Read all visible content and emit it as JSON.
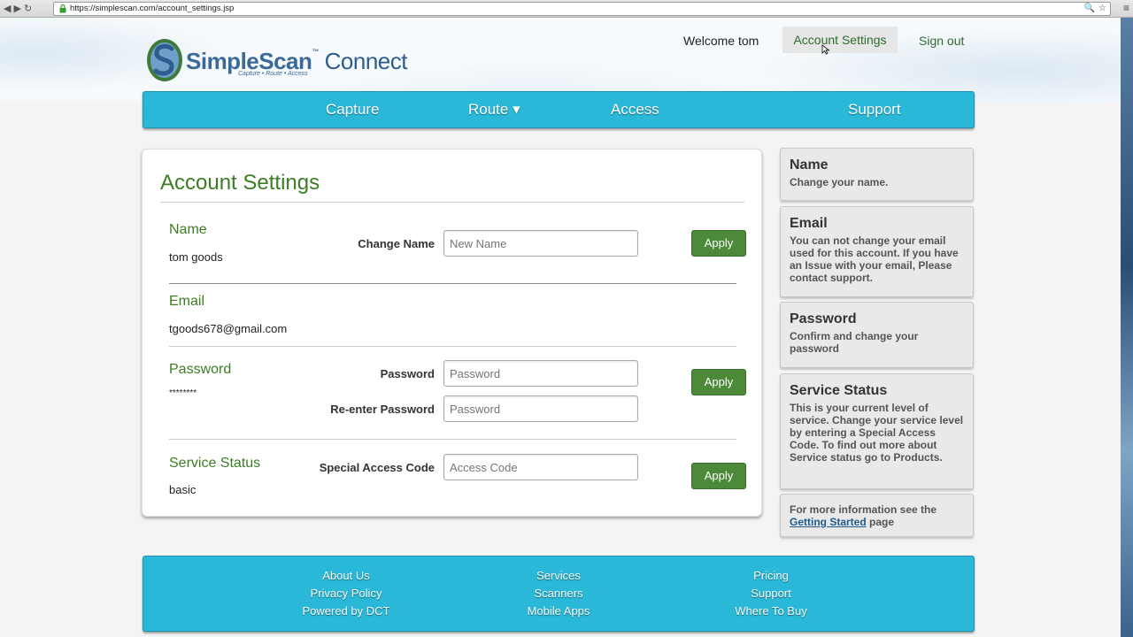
{
  "browser": {
    "url": "https://simplescan.com/account_settings.jsp",
    "nav_glyphs": "◀ ▶ ↻"
  },
  "logo": {
    "brand": "SimpleScan",
    "tm": "™",
    "product": "Connect",
    "tagline": "Capture • Route • Access"
  },
  "header": {
    "welcome": "Welcome tom",
    "account_settings": "Account Settings",
    "sign_out": "Sign out"
  },
  "nav": {
    "capture": "Capture",
    "route": "Route ▾",
    "access": "Access",
    "support": "Support"
  },
  "main": {
    "title": "Account Settings",
    "name": {
      "label": "Name",
      "value": "tom goods",
      "field_label": "Change Name",
      "placeholder": "New Name",
      "apply": "Apply"
    },
    "email": {
      "label": "Email",
      "value": "tgoods678@gmail.com"
    },
    "password": {
      "label": "Password",
      "value": "********",
      "field_label": "Password",
      "placeholder": "Password",
      "reenter_label": "Re-enter Password",
      "reenter_placeholder": "Password",
      "apply": "Apply"
    },
    "service": {
      "label": "Service Status",
      "value": "basic",
      "field_label": "Special Access Code",
      "placeholder": "Access Code",
      "apply": "Apply"
    }
  },
  "sidebar": {
    "name": {
      "title": "Name",
      "text": "Change your name."
    },
    "email": {
      "title": "Email",
      "text": "You can not change your email used for this account. If you have an Issue with your email, Please contact support."
    },
    "password": {
      "title": "Password",
      "text": "Confirm and change your password"
    },
    "service": {
      "title": "Service Status",
      "text": "This is your current level of service. Change your service level by entering a Special Access Code. To find out more about Service status go to Products."
    },
    "info": {
      "text_before": "For more information see the",
      "link": "Getting Started",
      "text_after": "page"
    }
  },
  "footer": {
    "col1": [
      "About Us",
      "Privacy Policy",
      "Powered by DCT"
    ],
    "col2": [
      "Services",
      "Scanners",
      "Mobile Apps"
    ],
    "col3": [
      "Pricing",
      "Support",
      "Where To Buy"
    ]
  },
  "colors": {
    "accent_blue": "#29b8d8",
    "green_label": "#3b7d23",
    "apply_green": "#4c8a3a"
  }
}
